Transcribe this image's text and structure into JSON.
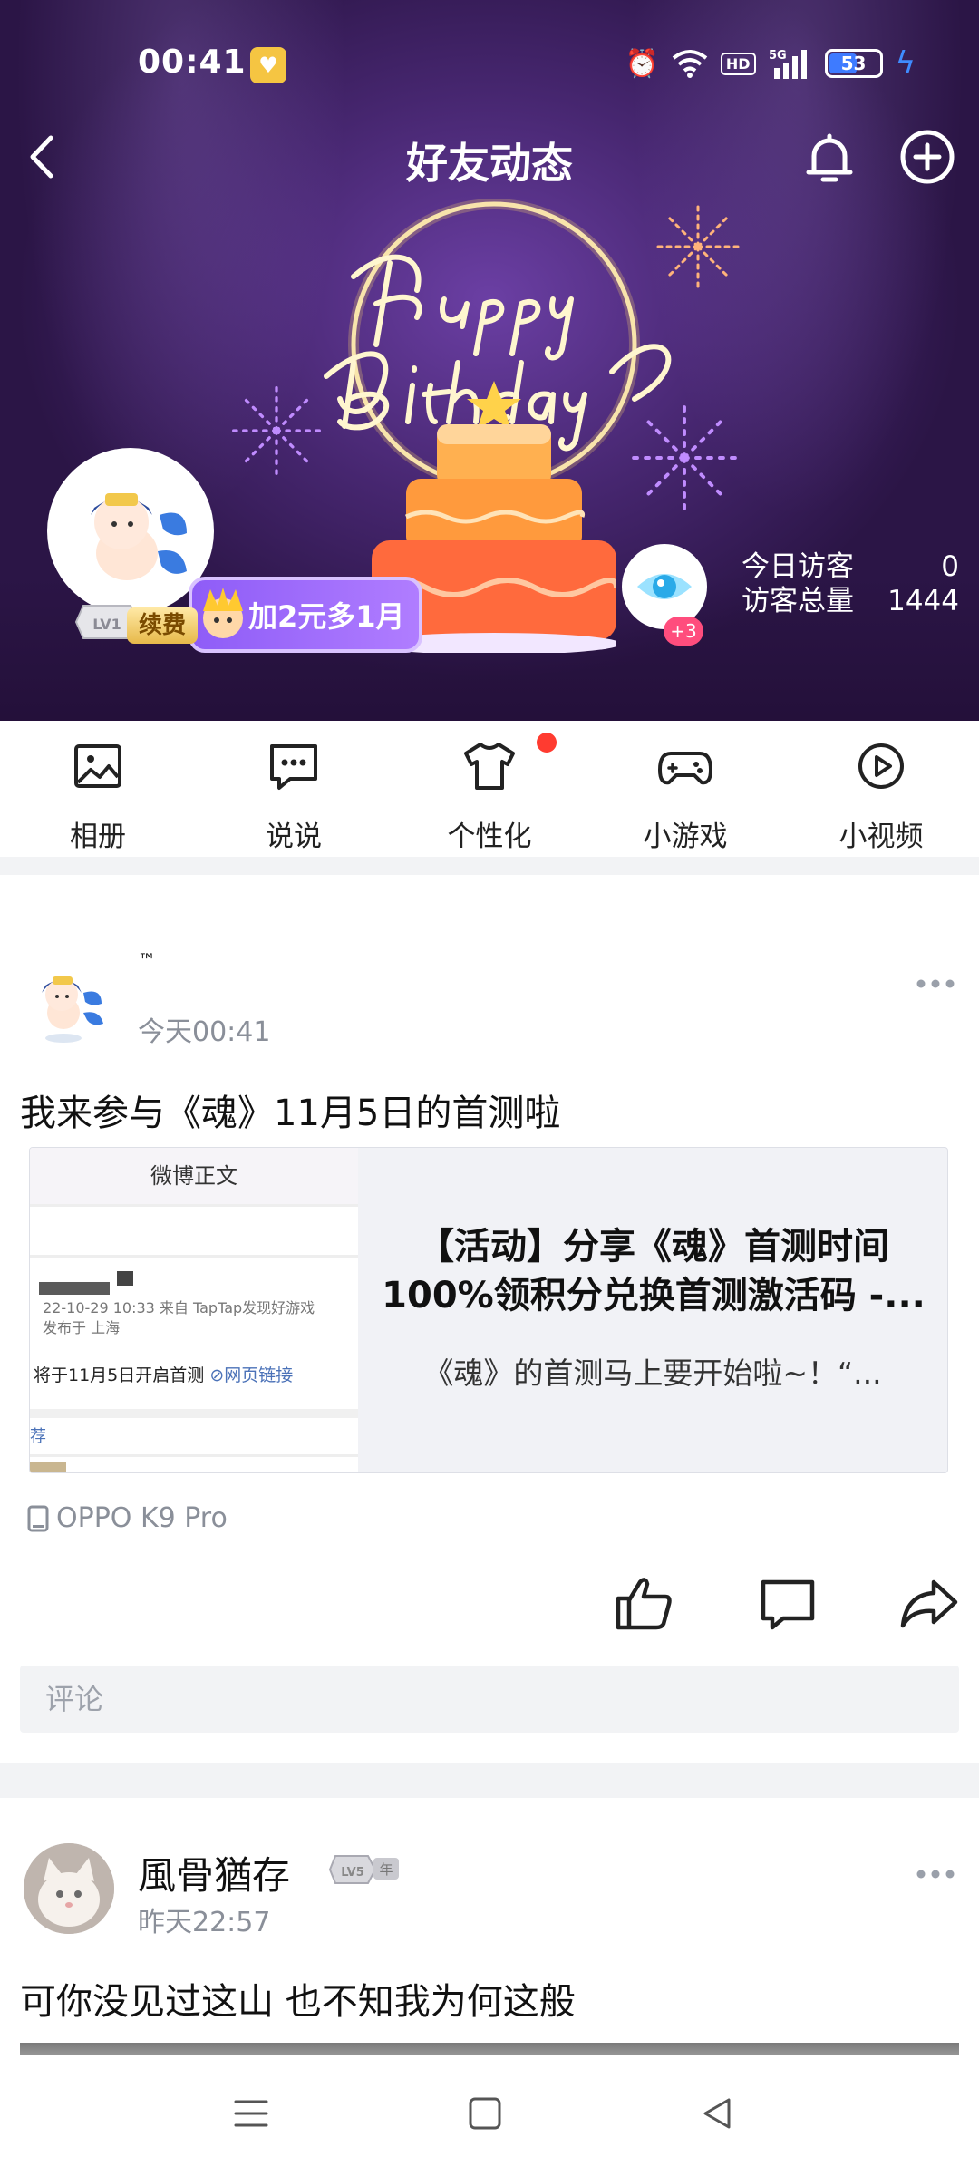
{
  "status_bar": {
    "time": "00:41",
    "hd_label": "HD",
    "network_label": "5G",
    "battery_level": "53"
  },
  "header": {
    "title": "好友动态"
  },
  "profile": {
    "level_label": "LV1",
    "renew_label": "续费",
    "vip_promo": "加2元多1月",
    "visitor_badge": "+3",
    "visitors_today_label": "今日访客",
    "visitors_today_value": "0",
    "visitors_total_label": "访客总量",
    "visitors_total_value": "1444"
  },
  "features": [
    {
      "label": "相册",
      "icon": "photo-album-icon"
    },
    {
      "label": "说说",
      "icon": "chat-bubble-icon"
    },
    {
      "label": "个性化",
      "icon": "tshirt-icon"
    },
    {
      "label": "小游戏",
      "icon": "gamepad-icon"
    },
    {
      "label": "小视频",
      "icon": "video-play-icon"
    }
  ],
  "posts": [
    {
      "author": "™",
      "time": "今天00:41",
      "text": "我来参与《魂》11月5日的首测啦",
      "link_card": {
        "thumb_header": "微博正文",
        "thumb_meta_line1": "22-10-29 10:33  来自 TapTap发现好游戏",
        "thumb_meta_line2": "发布于 上海",
        "thumb_text": "将于11月5日开启首测",
        "thumb_link": "网页链接",
        "thumb_rec": "荐",
        "title": "【活动】分享《魂》首测时间100%领积分兑换首测激活码 -...",
        "description": "《魂》的首测马上要开始啦~！“..."
      },
      "device": "OPPO K9 Pro",
      "comment_placeholder": "评论"
    },
    {
      "author": "風骨猶存",
      "level_label": "LV5",
      "year_label": "年",
      "time": "昨天22:57",
      "text": "可你没见过这山 也不知我为何这般"
    }
  ],
  "colors": {
    "hero_purple": "#46266f",
    "accent_red": "#ff3b30",
    "vip_purple": "#8e5cf7",
    "muted_text": "#8a8f99"
  }
}
